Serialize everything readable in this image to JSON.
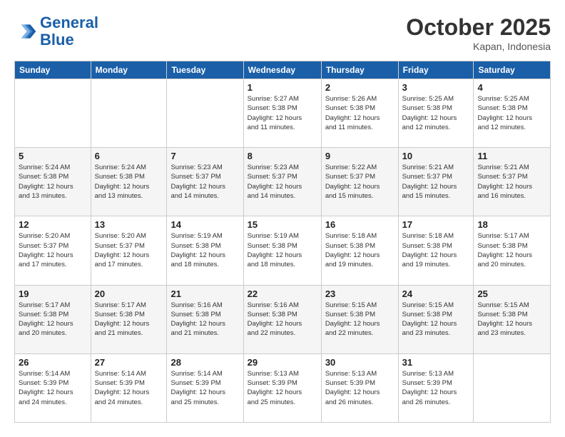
{
  "header": {
    "logo_line1": "General",
    "logo_line2": "Blue",
    "month": "October 2025",
    "location": "Kapan, Indonesia"
  },
  "columns": [
    "Sunday",
    "Monday",
    "Tuesday",
    "Wednesday",
    "Thursday",
    "Friday",
    "Saturday"
  ],
  "weeks": [
    [
      {
        "num": "",
        "info": ""
      },
      {
        "num": "",
        "info": ""
      },
      {
        "num": "",
        "info": ""
      },
      {
        "num": "1",
        "info": "Sunrise: 5:27 AM\nSunset: 5:38 PM\nDaylight: 12 hours\nand 11 minutes."
      },
      {
        "num": "2",
        "info": "Sunrise: 5:26 AM\nSunset: 5:38 PM\nDaylight: 12 hours\nand 11 minutes."
      },
      {
        "num": "3",
        "info": "Sunrise: 5:25 AM\nSunset: 5:38 PM\nDaylight: 12 hours\nand 12 minutes."
      },
      {
        "num": "4",
        "info": "Sunrise: 5:25 AM\nSunset: 5:38 PM\nDaylight: 12 hours\nand 12 minutes."
      }
    ],
    [
      {
        "num": "5",
        "info": "Sunrise: 5:24 AM\nSunset: 5:38 PM\nDaylight: 12 hours\nand 13 minutes."
      },
      {
        "num": "6",
        "info": "Sunrise: 5:24 AM\nSunset: 5:38 PM\nDaylight: 12 hours\nand 13 minutes."
      },
      {
        "num": "7",
        "info": "Sunrise: 5:23 AM\nSunset: 5:37 PM\nDaylight: 12 hours\nand 14 minutes."
      },
      {
        "num": "8",
        "info": "Sunrise: 5:23 AM\nSunset: 5:37 PM\nDaylight: 12 hours\nand 14 minutes."
      },
      {
        "num": "9",
        "info": "Sunrise: 5:22 AM\nSunset: 5:37 PM\nDaylight: 12 hours\nand 15 minutes."
      },
      {
        "num": "10",
        "info": "Sunrise: 5:21 AM\nSunset: 5:37 PM\nDaylight: 12 hours\nand 15 minutes."
      },
      {
        "num": "11",
        "info": "Sunrise: 5:21 AM\nSunset: 5:37 PM\nDaylight: 12 hours\nand 16 minutes."
      }
    ],
    [
      {
        "num": "12",
        "info": "Sunrise: 5:20 AM\nSunset: 5:37 PM\nDaylight: 12 hours\nand 17 minutes."
      },
      {
        "num": "13",
        "info": "Sunrise: 5:20 AM\nSunset: 5:37 PM\nDaylight: 12 hours\nand 17 minutes."
      },
      {
        "num": "14",
        "info": "Sunrise: 5:19 AM\nSunset: 5:38 PM\nDaylight: 12 hours\nand 18 minutes."
      },
      {
        "num": "15",
        "info": "Sunrise: 5:19 AM\nSunset: 5:38 PM\nDaylight: 12 hours\nand 18 minutes."
      },
      {
        "num": "16",
        "info": "Sunrise: 5:18 AM\nSunset: 5:38 PM\nDaylight: 12 hours\nand 19 minutes."
      },
      {
        "num": "17",
        "info": "Sunrise: 5:18 AM\nSunset: 5:38 PM\nDaylight: 12 hours\nand 19 minutes."
      },
      {
        "num": "18",
        "info": "Sunrise: 5:17 AM\nSunset: 5:38 PM\nDaylight: 12 hours\nand 20 minutes."
      }
    ],
    [
      {
        "num": "19",
        "info": "Sunrise: 5:17 AM\nSunset: 5:38 PM\nDaylight: 12 hours\nand 20 minutes."
      },
      {
        "num": "20",
        "info": "Sunrise: 5:17 AM\nSunset: 5:38 PM\nDaylight: 12 hours\nand 21 minutes."
      },
      {
        "num": "21",
        "info": "Sunrise: 5:16 AM\nSunset: 5:38 PM\nDaylight: 12 hours\nand 21 minutes."
      },
      {
        "num": "22",
        "info": "Sunrise: 5:16 AM\nSunset: 5:38 PM\nDaylight: 12 hours\nand 22 minutes."
      },
      {
        "num": "23",
        "info": "Sunrise: 5:15 AM\nSunset: 5:38 PM\nDaylight: 12 hours\nand 22 minutes."
      },
      {
        "num": "24",
        "info": "Sunrise: 5:15 AM\nSunset: 5:38 PM\nDaylight: 12 hours\nand 23 minutes."
      },
      {
        "num": "25",
        "info": "Sunrise: 5:15 AM\nSunset: 5:38 PM\nDaylight: 12 hours\nand 23 minutes."
      }
    ],
    [
      {
        "num": "26",
        "info": "Sunrise: 5:14 AM\nSunset: 5:39 PM\nDaylight: 12 hours\nand 24 minutes."
      },
      {
        "num": "27",
        "info": "Sunrise: 5:14 AM\nSunset: 5:39 PM\nDaylight: 12 hours\nand 24 minutes."
      },
      {
        "num": "28",
        "info": "Sunrise: 5:14 AM\nSunset: 5:39 PM\nDaylight: 12 hours\nand 25 minutes."
      },
      {
        "num": "29",
        "info": "Sunrise: 5:13 AM\nSunset: 5:39 PM\nDaylight: 12 hours\nand 25 minutes."
      },
      {
        "num": "30",
        "info": "Sunrise: 5:13 AM\nSunset: 5:39 PM\nDaylight: 12 hours\nand 26 minutes."
      },
      {
        "num": "31",
        "info": "Sunrise: 5:13 AM\nSunset: 5:39 PM\nDaylight: 12 hours\nand 26 minutes."
      },
      {
        "num": "",
        "info": ""
      }
    ]
  ]
}
